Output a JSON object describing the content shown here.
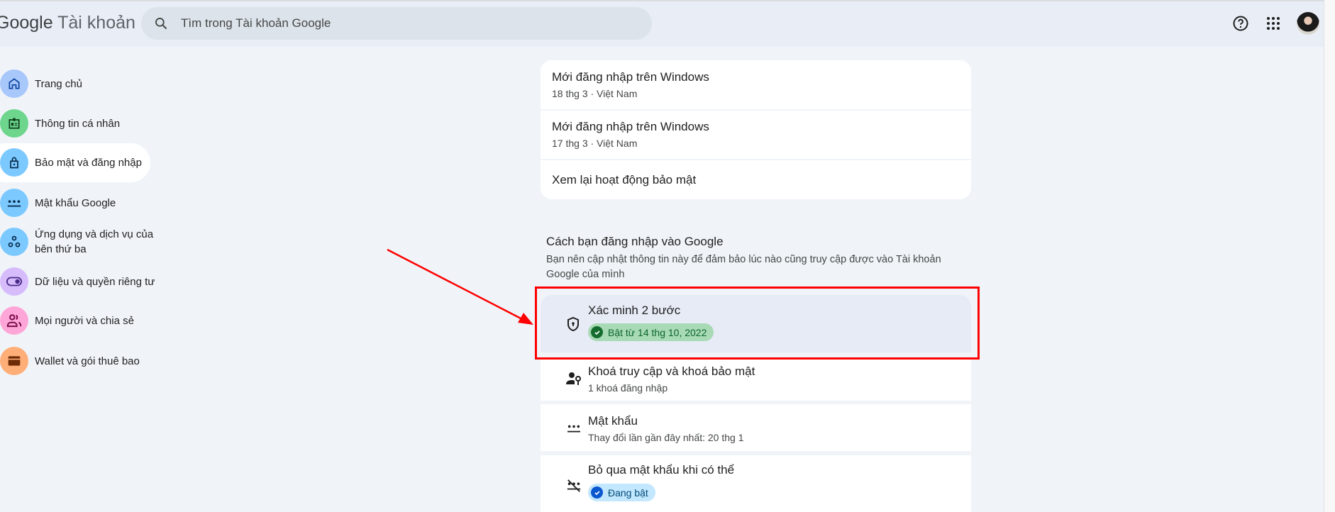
{
  "header": {
    "logo": "Google",
    "product": "Tài khoản",
    "search_placeholder": "Tìm trong Tài khoản Google"
  },
  "sidebar": {
    "items": [
      {
        "label": "Trang chủ",
        "icon": "home-icon",
        "color": "#a8c7fa"
      },
      {
        "label": "Thông tin cá nhân",
        "icon": "id-card-icon",
        "color": "#6dd58c"
      },
      {
        "label": "Bảo mật và đăng nhập",
        "icon": "lock-icon",
        "color": "#7cc9ff",
        "active": true
      },
      {
        "label": "Mật khẩu Google",
        "icon": "password-icon",
        "color": "#7cc9ff"
      },
      {
        "label": "Ứng dụng và dịch vụ của bên thứ ba",
        "icon": "apps-connection-icon",
        "color": "#7cc9ff"
      },
      {
        "label": "Dữ liệu và quyền riêng tư",
        "icon": "toggle-icon",
        "color": "#d7bcfc"
      },
      {
        "label": "Mọi người và chia sẻ",
        "icon": "people-icon",
        "color": "#ffa6d8"
      },
      {
        "label": "Wallet và gói thuê bao",
        "icon": "wallet-icon",
        "color": "#ffae78"
      }
    ]
  },
  "activity": {
    "items": [
      {
        "title": "Mới đăng nhập trên Windows",
        "sub": "18 thg 3 · Việt Nam"
      },
      {
        "title": "Mới đăng nhập trên Windows",
        "sub": "17 thg 3 · Việt Nam"
      }
    ],
    "review_link": "Xem lại hoạt động bảo mật"
  },
  "signin": {
    "heading": "Cách bạn đăng nhập vào Google",
    "description_1": "Bạn nên cập nhật thông tin này để đảm bảo lúc nào cũng truy cập được vào Tài khoản",
    "description_2": "Google của mình",
    "two_step": {
      "title": "Xác minh 2 bước",
      "badge": "Bật từ 14 thg 10, 2022"
    },
    "passkeys": {
      "title": "Khoá truy cập và khoá bảo mật",
      "sub": "1 khoá đăng nhập"
    },
    "password": {
      "title": "Mật khẩu",
      "sub": "Thay đổi lần gần đây nhất: 20 thg 1"
    },
    "skip_password": {
      "title": "Bỏ qua mật khẩu khi có thể",
      "badge": "Đang bật"
    }
  },
  "colors": {
    "highlight": "#ff0000",
    "green_badge": "#c4eed0",
    "blue_badge": "#c2e7ff"
  }
}
